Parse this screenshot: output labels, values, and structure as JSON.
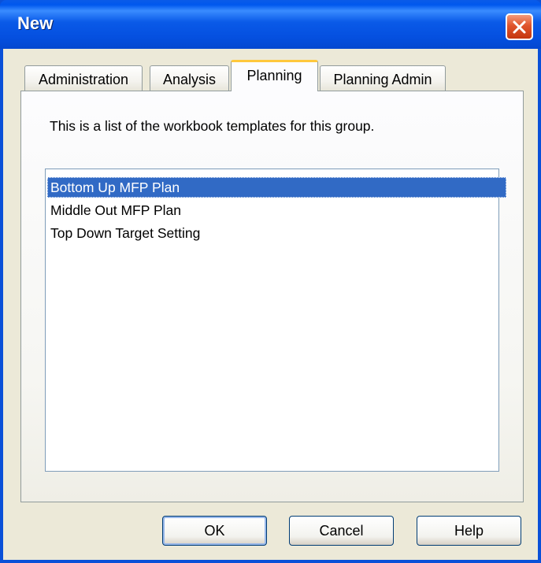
{
  "window": {
    "title": "New",
    "close_icon": "close-icon"
  },
  "tabs": [
    {
      "label": "Administration",
      "active": false
    },
    {
      "label": "Analysis",
      "active": false
    },
    {
      "label": "Planning",
      "active": true
    },
    {
      "label": "Planning Admin",
      "active": false
    }
  ],
  "panel": {
    "description": "This is a list of the workbook templates for this group.",
    "templates": [
      {
        "label": "Bottom Up MFP Plan",
        "selected": true
      },
      {
        "label": "Middle Out MFP Plan",
        "selected": false
      },
      {
        "label": "Top Down Target Setting",
        "selected": false
      }
    ]
  },
  "buttons": {
    "ok": "OK",
    "cancel": "Cancel",
    "help": "Help"
  },
  "colors": {
    "titlebar": "#0a5ae8",
    "selection": "#316ac5",
    "dialog_face": "#ece9d8",
    "active_tab_accent": "#ffc83c"
  }
}
